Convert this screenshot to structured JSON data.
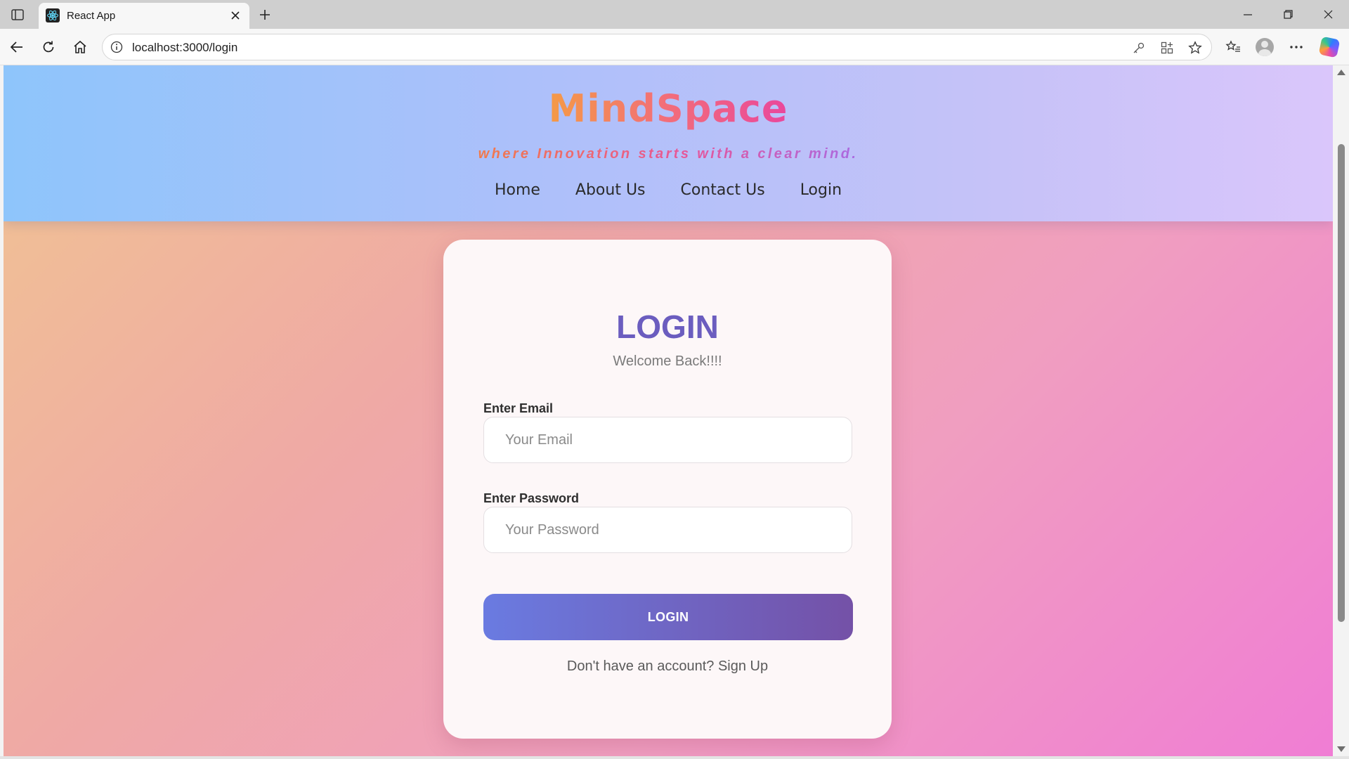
{
  "browser": {
    "tab_title": "React App",
    "url": "localhost:3000/login"
  },
  "site": {
    "brand": "MindSpace",
    "tagline": "where Innovation starts with a clear mind.",
    "nav": [
      "Home",
      "About Us",
      "Contact Us",
      "Login"
    ]
  },
  "login": {
    "title": "LOGIN",
    "subtitle": "Welcome Back!!!!",
    "email_label": "Enter Email",
    "email_placeholder": "Your Email",
    "password_label": "Enter Password",
    "password_placeholder": "Your Password",
    "button_label": "LOGIN",
    "signup_prompt": "Don't have an account?",
    "signup_link": "Sign Up"
  },
  "colors": {
    "accent": "#6b5dbf",
    "button_start": "#6a7be1",
    "button_end": "#7451a7"
  }
}
